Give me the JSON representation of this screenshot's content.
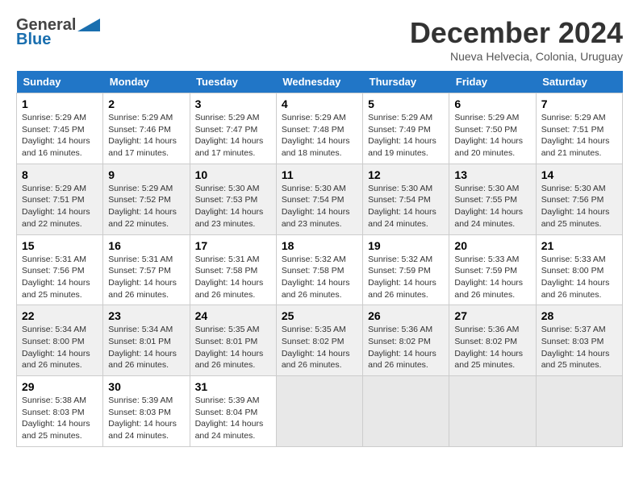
{
  "header": {
    "logo_general": "General",
    "logo_blue": "Blue",
    "month_title": "December 2024",
    "location": "Nueva Helvecia, Colonia, Uruguay"
  },
  "calendar": {
    "days_of_week": [
      "Sunday",
      "Monday",
      "Tuesday",
      "Wednesday",
      "Thursday",
      "Friday",
      "Saturday"
    ],
    "weeks": [
      [
        {
          "day": "",
          "info": ""
        },
        {
          "day": "2",
          "sunrise": "Sunrise: 5:29 AM",
          "sunset": "Sunset: 7:46 PM",
          "daylight": "Daylight: 14 hours and 17 minutes."
        },
        {
          "day": "3",
          "sunrise": "Sunrise: 5:29 AM",
          "sunset": "Sunset: 7:47 PM",
          "daylight": "Daylight: 14 hours and 17 minutes."
        },
        {
          "day": "4",
          "sunrise": "Sunrise: 5:29 AM",
          "sunset": "Sunset: 7:48 PM",
          "daylight": "Daylight: 14 hours and 18 minutes."
        },
        {
          "day": "5",
          "sunrise": "Sunrise: 5:29 AM",
          "sunset": "Sunset: 7:49 PM",
          "daylight": "Daylight: 14 hours and 19 minutes."
        },
        {
          "day": "6",
          "sunrise": "Sunrise: 5:29 AM",
          "sunset": "Sunset: 7:50 PM",
          "daylight": "Daylight: 14 hours and 20 minutes."
        },
        {
          "day": "7",
          "sunrise": "Sunrise: 5:29 AM",
          "sunset": "Sunset: 7:51 PM",
          "daylight": "Daylight: 14 hours and 21 minutes."
        }
      ],
      [
        {
          "day": "1",
          "sunrise": "Sunrise: 5:29 AM",
          "sunset": "Sunset: 7:45 PM",
          "daylight": "Daylight: 14 hours and 16 minutes."
        },
        {
          "day": "9",
          "sunrise": "Sunrise: 5:29 AM",
          "sunset": "Sunset: 7:52 PM",
          "daylight": "Daylight: 14 hours and 22 minutes."
        },
        {
          "day": "10",
          "sunrise": "Sunrise: 5:30 AM",
          "sunset": "Sunset: 7:53 PM",
          "daylight": "Daylight: 14 hours and 23 minutes."
        },
        {
          "day": "11",
          "sunrise": "Sunrise: 5:30 AM",
          "sunset": "Sunset: 7:54 PM",
          "daylight": "Daylight: 14 hours and 23 minutes."
        },
        {
          "day": "12",
          "sunrise": "Sunrise: 5:30 AM",
          "sunset": "Sunset: 7:54 PM",
          "daylight": "Daylight: 14 hours and 24 minutes."
        },
        {
          "day": "13",
          "sunrise": "Sunrise: 5:30 AM",
          "sunset": "Sunset: 7:55 PM",
          "daylight": "Daylight: 14 hours and 24 minutes."
        },
        {
          "day": "14",
          "sunrise": "Sunrise: 5:30 AM",
          "sunset": "Sunset: 7:56 PM",
          "daylight": "Daylight: 14 hours and 25 minutes."
        }
      ],
      [
        {
          "day": "8",
          "sunrise": "Sunrise: 5:29 AM",
          "sunset": "Sunset: 7:51 PM",
          "daylight": "Daylight: 14 hours and 22 minutes."
        },
        {
          "day": "16",
          "sunrise": "Sunrise: 5:31 AM",
          "sunset": "Sunset: 7:57 PM",
          "daylight": "Daylight: 14 hours and 26 minutes."
        },
        {
          "day": "17",
          "sunrise": "Sunrise: 5:31 AM",
          "sunset": "Sunset: 7:58 PM",
          "daylight": "Daylight: 14 hours and 26 minutes."
        },
        {
          "day": "18",
          "sunrise": "Sunrise: 5:32 AM",
          "sunset": "Sunset: 7:58 PM",
          "daylight": "Daylight: 14 hours and 26 minutes."
        },
        {
          "day": "19",
          "sunrise": "Sunrise: 5:32 AM",
          "sunset": "Sunset: 7:59 PM",
          "daylight": "Daylight: 14 hours and 26 minutes."
        },
        {
          "day": "20",
          "sunrise": "Sunrise: 5:33 AM",
          "sunset": "Sunset: 7:59 PM",
          "daylight": "Daylight: 14 hours and 26 minutes."
        },
        {
          "day": "21",
          "sunrise": "Sunrise: 5:33 AM",
          "sunset": "Sunset: 8:00 PM",
          "daylight": "Daylight: 14 hours and 26 minutes."
        }
      ],
      [
        {
          "day": "15",
          "sunrise": "Sunrise: 5:31 AM",
          "sunset": "Sunset: 7:56 PM",
          "daylight": "Daylight: 14 hours and 25 minutes."
        },
        {
          "day": "23",
          "sunrise": "Sunrise: 5:34 AM",
          "sunset": "Sunset: 8:01 PM",
          "daylight": "Daylight: 14 hours and 26 minutes."
        },
        {
          "day": "24",
          "sunrise": "Sunrise: 5:35 AM",
          "sunset": "Sunset: 8:01 PM",
          "daylight": "Daylight: 14 hours and 26 minutes."
        },
        {
          "day": "25",
          "sunrise": "Sunrise: 5:35 AM",
          "sunset": "Sunset: 8:02 PM",
          "daylight": "Daylight: 14 hours and 26 minutes."
        },
        {
          "day": "26",
          "sunrise": "Sunrise: 5:36 AM",
          "sunset": "Sunset: 8:02 PM",
          "daylight": "Daylight: 14 hours and 26 minutes."
        },
        {
          "day": "27",
          "sunrise": "Sunrise: 5:36 AM",
          "sunset": "Sunset: 8:02 PM",
          "daylight": "Daylight: 14 hours and 25 minutes."
        },
        {
          "day": "28",
          "sunrise": "Sunrise: 5:37 AM",
          "sunset": "Sunset: 8:03 PM",
          "daylight": "Daylight: 14 hours and 25 minutes."
        }
      ],
      [
        {
          "day": "22",
          "sunrise": "Sunrise: 5:34 AM",
          "sunset": "Sunset: 8:00 PM",
          "daylight": "Daylight: 14 hours and 26 minutes."
        },
        {
          "day": "30",
          "sunrise": "Sunrise: 5:39 AM",
          "sunset": "Sunset: 8:03 PM",
          "daylight": "Daylight: 14 hours and 24 minutes."
        },
        {
          "day": "31",
          "sunrise": "Sunrise: 5:39 AM",
          "sunset": "Sunset: 8:04 PM",
          "daylight": "Daylight: 14 hours and 24 minutes."
        },
        {
          "day": "",
          "info": ""
        },
        {
          "day": "",
          "info": ""
        },
        {
          "day": "",
          "info": ""
        },
        {
          "day": "",
          "info": ""
        }
      ],
      [
        {
          "day": "29",
          "sunrise": "Sunrise: 5:38 AM",
          "sunset": "Sunset: 8:03 PM",
          "daylight": "Daylight: 14 hours and 25 minutes."
        },
        {
          "day": "",
          "info": ""
        },
        {
          "day": "",
          "info": ""
        },
        {
          "day": "",
          "info": ""
        },
        {
          "day": "",
          "info": ""
        },
        {
          "day": "",
          "info": ""
        },
        {
          "day": "",
          "info": ""
        }
      ]
    ]
  }
}
